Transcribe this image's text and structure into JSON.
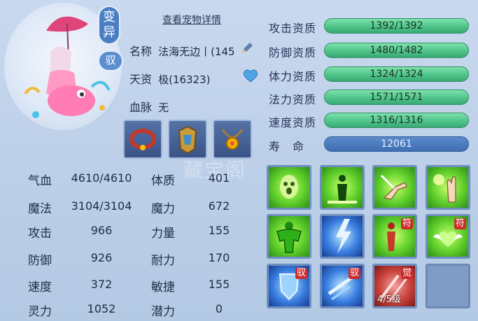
{
  "pet": {
    "variant_label": "变异",
    "drive_label": "驭",
    "details_link": "查看宠物详情",
    "name_label": "名称",
    "name_value": "法海无边丨(145",
    "aptitude_label": "天资",
    "aptitude_value": "极(16323)",
    "bloodline_label": "血脉",
    "bloodline_value": "无"
  },
  "stats": [
    {
      "label": "气血",
      "value": "4610/4610"
    },
    {
      "label": "体质",
      "value": "401"
    },
    {
      "label": "魔法",
      "value": "3104/3104"
    },
    {
      "label": "魔力",
      "value": "672"
    },
    {
      "label": "攻击",
      "value": "966"
    },
    {
      "label": "力量",
      "value": "155"
    },
    {
      "label": "防御",
      "value": "926"
    },
    {
      "label": "耐力",
      "value": "170"
    },
    {
      "label": "速度",
      "value": "372"
    },
    {
      "label": "敏捷",
      "value": "155"
    },
    {
      "label": "灵力",
      "value": "1052"
    },
    {
      "label": "潜力",
      "value": "0"
    }
  ],
  "attributes": [
    {
      "label": "攻击资质",
      "value": "1392/1392",
      "fill": 1.0
    },
    {
      "label": "防御资质",
      "value": "1480/1482",
      "fill": 0.9986
    },
    {
      "label": "体力资质",
      "value": "1324/1324",
      "fill": 1.0
    },
    {
      "label": "法力资质",
      "value": "1571/1571",
      "fill": 1.0
    },
    {
      "label": "速度资质",
      "value": "1316/1316",
      "fill": 1.0
    },
    {
      "label": "寿　命",
      "value": "12061"
    }
  ],
  "skills": [
    {
      "icon": "ghost-face-icon",
      "color": "green"
    },
    {
      "icon": "figure-light-icon",
      "color": "green"
    },
    {
      "icon": "hand-strike-icon",
      "color": "green"
    },
    {
      "icon": "palm-light-icon",
      "color": "green"
    },
    {
      "icon": "muscle-man-icon",
      "color": "green"
    },
    {
      "icon": "lightning-icon",
      "color": "blue"
    },
    {
      "icon": "talisman-figure-icon",
      "color": "green",
      "badge": "符"
    },
    {
      "icon": "wings-heart-icon",
      "color": "green",
      "badge": "符"
    },
    {
      "icon": "shield-icon",
      "color": "blue",
      "badge": "驭"
    },
    {
      "icon": "dash-icon",
      "color": "blue",
      "badge": "驭"
    },
    {
      "icon": "awaken-icon",
      "color": "red",
      "badge": "觉",
      "level": "4/5级"
    },
    {
      "icon": "empty-slot",
      "color": "empty"
    }
  ],
  "watermark": "藏宝阁",
  "colors": {
    "bar_green": "#4fc489",
    "bar_blue": "#3f6fb2",
    "panel": "#bccfe8"
  }
}
